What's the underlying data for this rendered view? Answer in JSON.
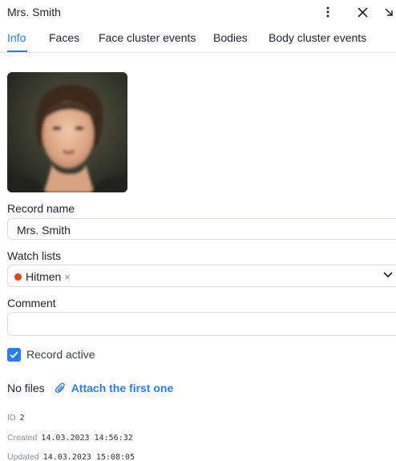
{
  "header": {
    "title": "Mrs. Smith"
  },
  "tabs": [
    {
      "label": "Info",
      "active": true
    },
    {
      "label": "Faces",
      "active": false
    },
    {
      "label": "Face cluster events",
      "active": false
    },
    {
      "label": "Bodies",
      "active": false
    },
    {
      "label": "Body cluster events",
      "active": false
    }
  ],
  "form": {
    "record_name_label": "Record name",
    "record_name_value": "Mrs. Smith",
    "watch_lists_label": "Watch lists",
    "watch_list_chip": {
      "label": "Hitmen",
      "color": "#e0441e"
    },
    "comment_label": "Comment",
    "comment_value": "",
    "record_active_label": "Record active",
    "record_active_checked": true
  },
  "files": {
    "status": "No files",
    "attach_label": "Attach the first one"
  },
  "meta": {
    "id_label": "ID",
    "id_value": "2",
    "created_label": "Created",
    "created_value": "14.03.2023 14:56:32",
    "updated_label": "Updated",
    "updated_value": "14.03.2023 15:08:05"
  },
  "colors": {
    "accent": "#2b7de9",
    "chip_dot": "#e0441e"
  },
  "icons": {
    "more": "more-vertical-icon",
    "close": "close-icon",
    "collapse": "arrow-down-right-icon",
    "chevron": "chevron-down-icon",
    "attach": "paperclip-icon",
    "check": "check-icon"
  }
}
